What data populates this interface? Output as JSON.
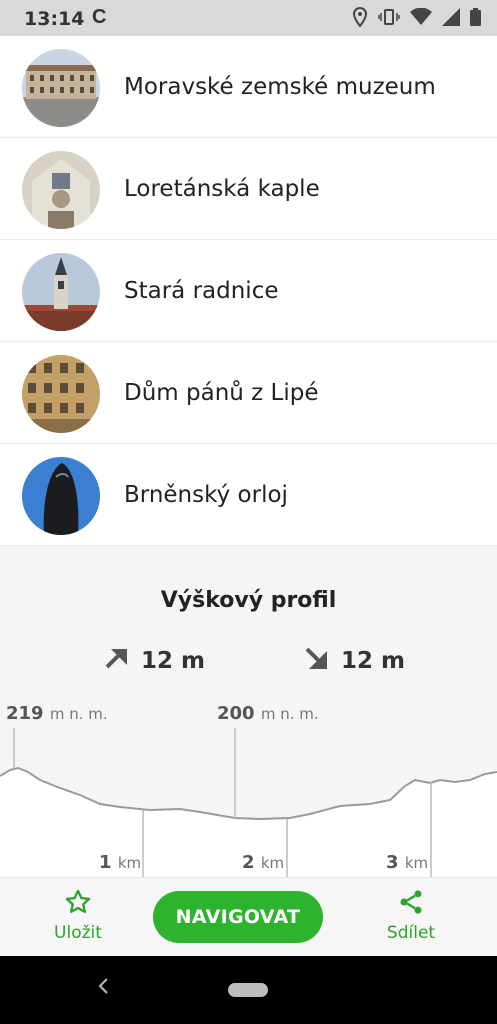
{
  "status_bar": {
    "time": "13:14",
    "app_icon": "C",
    "icons": [
      "location-icon",
      "vibrate-icon",
      "wifi-icon",
      "signal-icon",
      "battery-icon"
    ]
  },
  "places": [
    {
      "name": "Moravské zemské muzeum",
      "thumb": "museum-photo"
    },
    {
      "name": "Loretánská kaple",
      "thumb": "chapel-photo"
    },
    {
      "name": "Stará radnice",
      "thumb": "town-hall-photo"
    },
    {
      "name": "Dům pánů z Lipé",
      "thumb": "house-photo"
    },
    {
      "name": "Brněnský orloj",
      "thumb": "clock-photo"
    }
  ],
  "profile": {
    "title": "Výškový profil",
    "ascent": "12 m",
    "descent": "12 m",
    "elevation_labels": [
      {
        "value": "219",
        "unit": "m n. m."
      },
      {
        "value": "200",
        "unit": "m n. m."
      }
    ],
    "km_labels": [
      {
        "value": "1",
        "unit": "km"
      },
      {
        "value": "2",
        "unit": "km"
      },
      {
        "value": "3",
        "unit": "km"
      }
    ]
  },
  "bottom_bar": {
    "save_label": "Uložit",
    "navigate_label": "NAVIGOVAT",
    "share_label": "Sdílet"
  },
  "colors": {
    "accent_green": "#2db32d",
    "background": "#f5f5f5"
  }
}
